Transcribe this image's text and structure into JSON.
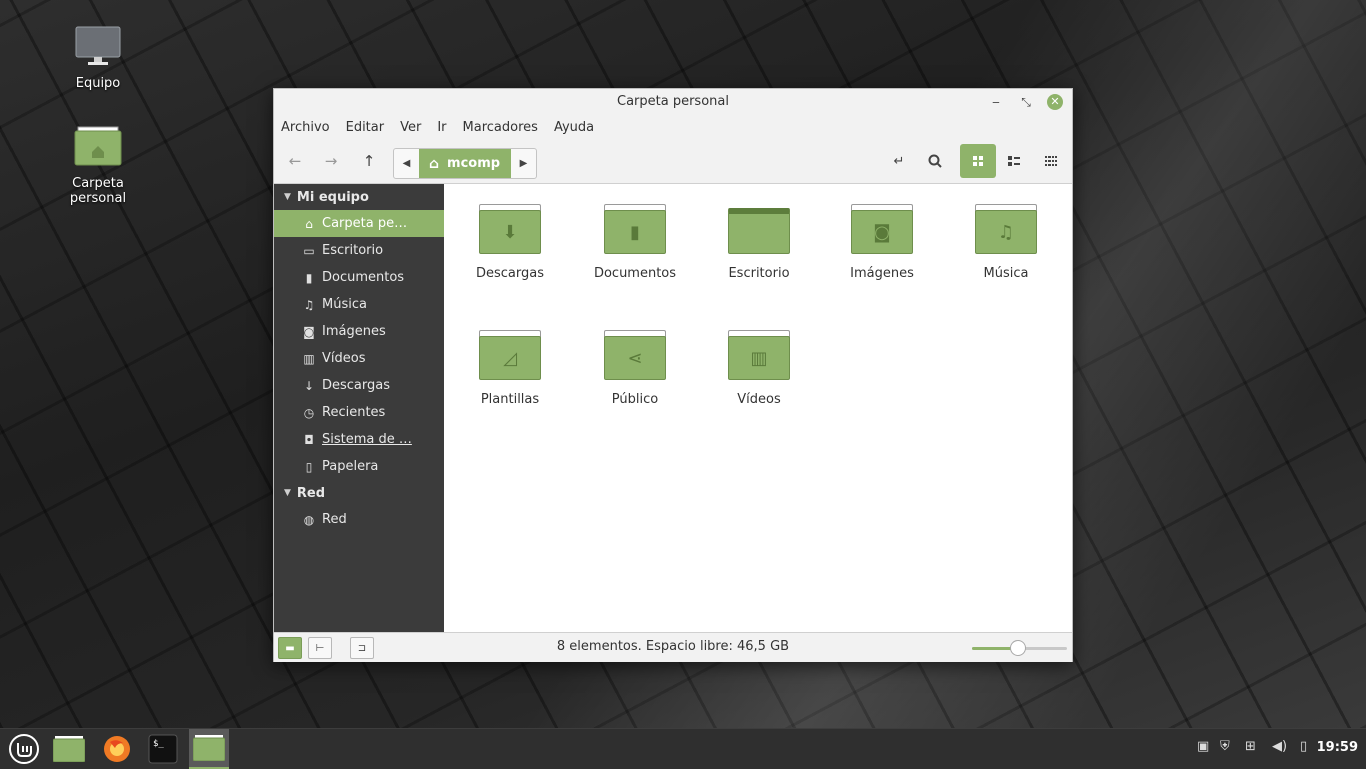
{
  "desktop": {
    "icons": [
      {
        "label": "Equipo"
      },
      {
        "label": "Carpeta personal"
      }
    ]
  },
  "window": {
    "title": "Carpeta personal",
    "menu": [
      "Archivo",
      "Editar",
      "Ver",
      "Ir",
      "Marcadores",
      "Ayuda"
    ],
    "path": {
      "crumb": "mcomp"
    },
    "sidebar": {
      "sections": [
        {
          "title": "Mi equipo"
        },
        {
          "title": "Red"
        }
      ],
      "items": [
        {
          "label": "Carpeta pe…",
          "icon": "home-icon"
        },
        {
          "label": "Escritorio",
          "icon": "desktop-icon"
        },
        {
          "label": "Documentos",
          "icon": "document-icon"
        },
        {
          "label": "Música",
          "icon": "music-icon"
        },
        {
          "label": "Imágenes",
          "icon": "camera-icon"
        },
        {
          "label": "Vídeos",
          "icon": "film-icon"
        },
        {
          "label": "Descargas",
          "icon": "download-icon"
        },
        {
          "label": "Recientes",
          "icon": "history-icon"
        },
        {
          "label": "Sistema de …",
          "icon": "drive-icon"
        },
        {
          "label": "Papelera",
          "icon": "trash-icon"
        },
        {
          "label": "Red",
          "icon": "globe-icon"
        }
      ]
    },
    "files": [
      {
        "label": "Descargas",
        "icon": "download-icon"
      },
      {
        "label": "Documentos",
        "icon": "document-icon"
      },
      {
        "label": "Escritorio",
        "icon": "desktop-icon"
      },
      {
        "label": "Imágenes",
        "icon": "camera-icon"
      },
      {
        "label": "Música",
        "icon": "music-icon"
      },
      {
        "label": "Plantillas",
        "icon": "template-icon"
      },
      {
        "label": "Público",
        "icon": "share-icon"
      },
      {
        "label": "Vídeos",
        "icon": "film-icon"
      }
    ],
    "status": "8 elementos. Espacio libre: 46,5 GB",
    "zoom_level": 0.48
  },
  "taskbar": {
    "clock": "19:59"
  },
  "colors": {
    "accent": "#8fb36a",
    "sidebar_bg": "#3b3b3b",
    "taskbar_bg": "#2f2f2f"
  }
}
